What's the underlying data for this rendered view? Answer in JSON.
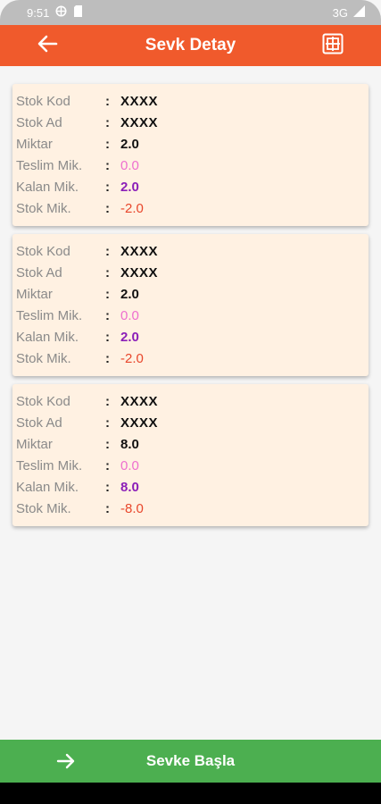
{
  "status_bar": {
    "time": "9:51",
    "network": "3G"
  },
  "app_bar": {
    "title": "Sevk Detay",
    "back_icon": "arrow-left-icon",
    "scan_icon": "barcode-scan-icon"
  },
  "colors": {
    "app_bar": "#f05a2c",
    "card_bg": "#fff1e2",
    "bottom_button": "#4caf50",
    "teslim": "#ee6fcf",
    "kalan": "#8b1fb8",
    "stok": "#e8462b"
  },
  "labels": {
    "stok_kod": "Stok Kod",
    "stok_ad": "Stok Ad",
    "miktar": "Miktar",
    "teslim": "Teslim Mik.",
    "kalan": "Kalan Mik.",
    "stok_mik": "Stok Mik.",
    "colon": ":"
  },
  "items": [
    {
      "stok_kod": "XXXX",
      "stok_ad": "XXXX",
      "miktar": "2.0",
      "teslim": "0.0",
      "kalan": "2.0",
      "stok_mik": "-2.0"
    },
    {
      "stok_kod": "XXXX",
      "stok_ad": "XXXX",
      "miktar": "2.0",
      "teslim": "0.0",
      "kalan": "2.0",
      "stok_mik": "-2.0"
    },
    {
      "stok_kod": "XXXX",
      "stok_ad": "XXXX",
      "miktar": "8.0",
      "teslim": "0.0",
      "kalan": "8.0",
      "stok_mik": "-8.0"
    }
  ],
  "bottom_button": {
    "label": "Sevke Başla",
    "icon": "arrow-right-icon"
  }
}
